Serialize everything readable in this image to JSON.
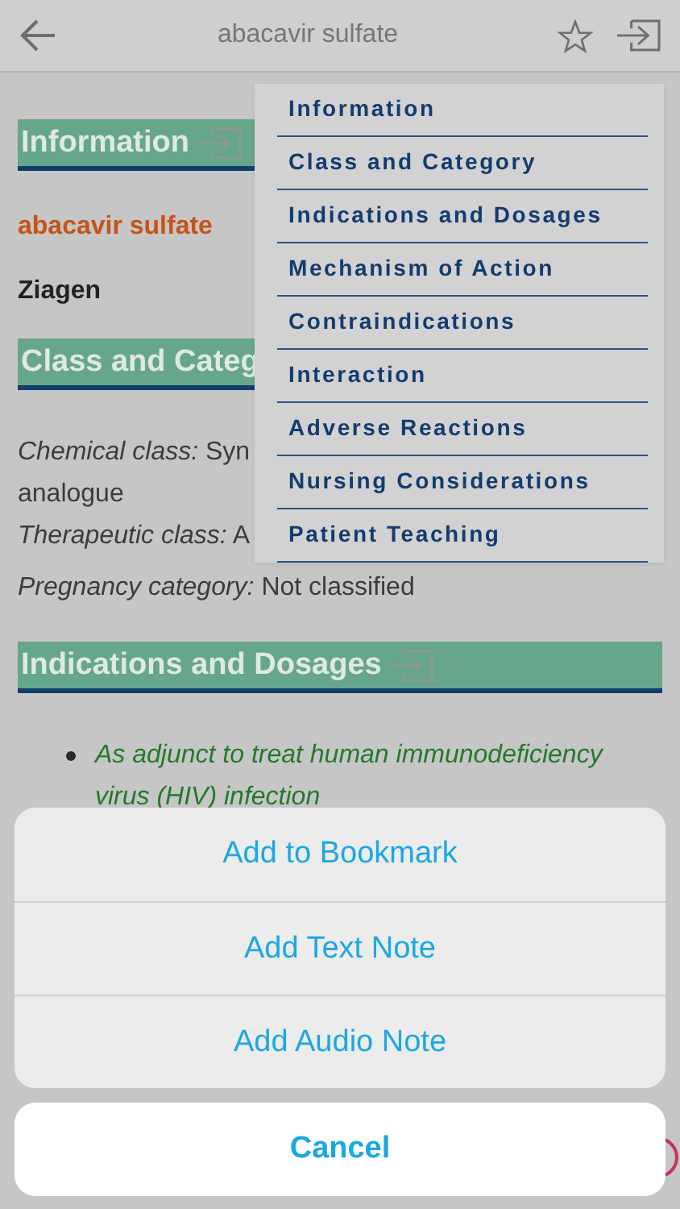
{
  "nav": {
    "title": "abacavir sulfate"
  },
  "content": [
    {
      "kind": "header",
      "text": "Information",
      "jump_icon": true
    },
    {
      "kind": "drug_name",
      "text": "abacavir sulfate"
    },
    {
      "kind": "brand",
      "text": "Ziagen"
    },
    {
      "kind": "header",
      "text": "Class and Categ",
      "jump_icon": false
    },
    {
      "kind": "field",
      "text": "*Chemical class:* Syn\nanalogue"
    },
    {
      "kind": "field",
      "text": "*Therapeutic class:* A"
    },
    {
      "kind": "field",
      "text": "*Pregnancy category:* Not classified"
    },
    {
      "kind": "header",
      "text": "Indications and Dosages",
      "jump_icon": true
    },
    {
      "kind": "bullet",
      "text": "As adjunct to treat human immunodeficiency virus (HIV) infection"
    }
  ],
  "menu": {
    "items": [
      "Information",
      "Class and Category",
      "Indications and Dosages",
      "Mechanism of Action",
      "Contraindications",
      "Interaction",
      "Adverse Reactions",
      "Nursing Considerations",
      "Patient Teaching"
    ]
  },
  "action_sheet": {
    "actions": [
      "Add to Bookmark",
      "Add Text Note",
      "Add Audio Note"
    ],
    "cancel": "Cancel"
  }
}
